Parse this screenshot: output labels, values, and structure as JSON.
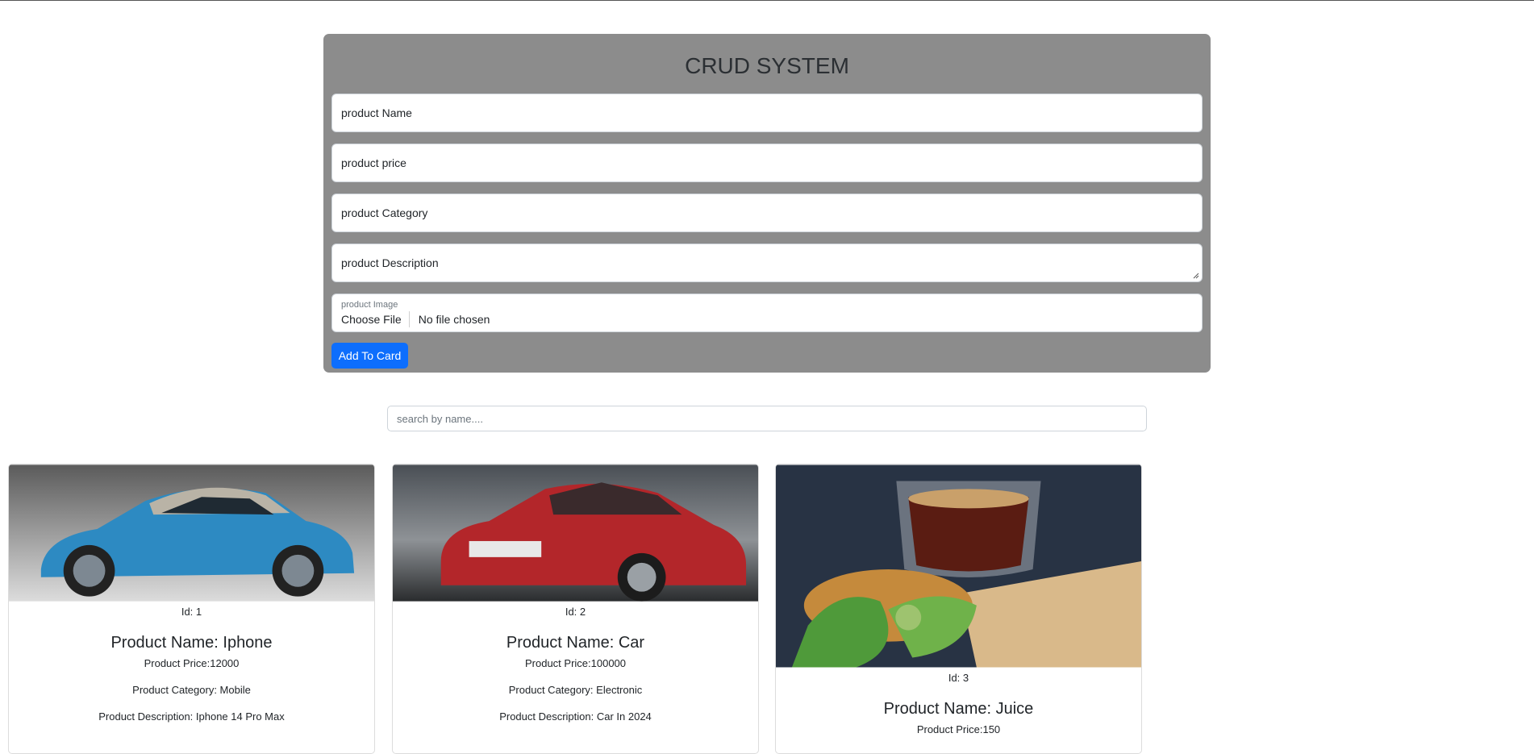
{
  "form": {
    "title": "CRUD SYSTEM",
    "name_placeholder": "product Name",
    "price_placeholder": "product price",
    "category_placeholder": "product Category",
    "description_placeholder": "product Description",
    "image_label": "product Image",
    "choose_file": "Choose File",
    "no_file": "No file chosen",
    "add_button": "Add To Card"
  },
  "search": {
    "placeholder": "search by name...."
  },
  "products": [
    {
      "id": "Id: 1",
      "name": "Product Name: Iphone",
      "price": "Product Price:12000",
      "category": "Product Category: Mobile",
      "description": "Product Description: Iphone 14 Pro Max"
    },
    {
      "id": "Id: 2",
      "name": "Product Name: Car",
      "price": "Product Price:100000",
      "category": "Product Category: Electronic",
      "description": "Product Description: Car In 2024"
    },
    {
      "id": "Id: 3",
      "name": "Product Name: Juice",
      "price": "Product Price:150",
      "category": "",
      "description": ""
    }
  ],
  "colors": {
    "panel": "#8c8c8c",
    "primary_button": "#0d6efd"
  }
}
